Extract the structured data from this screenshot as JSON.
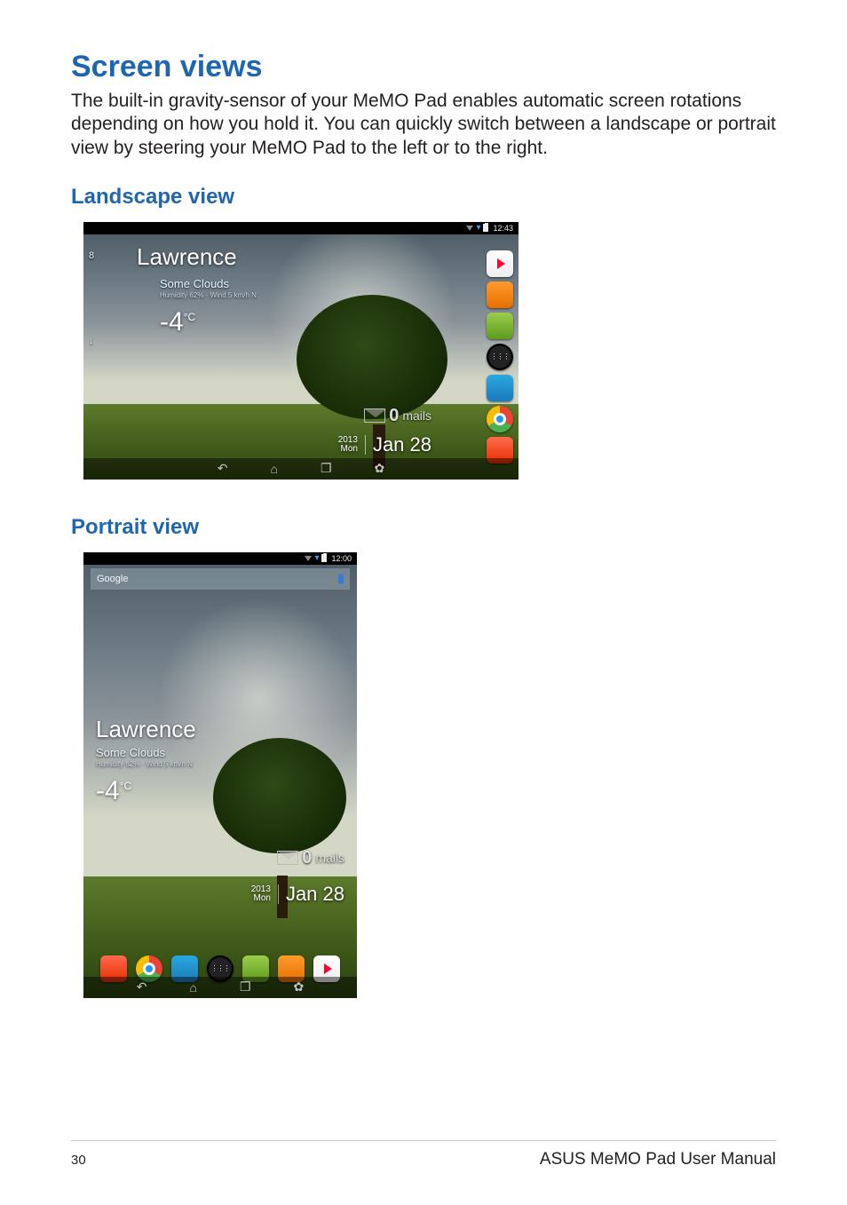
{
  "section": {
    "title": "Screen views",
    "body": "The built-in gravity-sensor of your MeMO Pad enables automatic screen rotations depending on how you hold it. You can quickly switch between a landscape or portrait view by steering your MeMO Pad to the left or to the right."
  },
  "landscape": {
    "heading": "Landscape view",
    "status_time": "12:43",
    "page_indicator_top": "8",
    "page_indicator_bottom": "↓",
    "weather": {
      "location": "Lawrence",
      "condition": "Some Clouds",
      "subline": "Humidity 62% · Wind 5 km/h N",
      "temperature": "-4",
      "temp_unit": "°C"
    },
    "mail": {
      "count": "0",
      "label": "mails"
    },
    "date": {
      "year": "2013",
      "dow": "Mon",
      "md": "Jan 28"
    },
    "quicklaunch": [
      "play-store",
      "audio-wizard",
      "supernote",
      "all-apps",
      "gallery",
      "chrome",
      "asus-studio"
    ],
    "navbar": [
      "back",
      "home",
      "recent",
      "screenshot"
    ]
  },
  "portrait": {
    "heading": "Portrait view",
    "status_time": "12:00",
    "search_placeholder": "Google",
    "weather": {
      "location": "Lawrence",
      "condition": "Some Clouds",
      "subline": "Humidity 62% · Wind 5 km/h N",
      "temperature": "-4",
      "temp_unit": "°C"
    },
    "mail": {
      "count": "0",
      "label": "mails"
    },
    "date": {
      "year": "2013",
      "dow": "Mon",
      "md": "Jan 28"
    },
    "quicklaunch": [
      "asus-studio",
      "chrome",
      "gallery",
      "all-apps",
      "supernote",
      "audio-wizard",
      "play-store"
    ],
    "navbar": [
      "back",
      "home",
      "recent",
      "screenshot"
    ]
  },
  "footer": {
    "page_number": "30",
    "title": "ASUS MeMO Pad User Manual"
  }
}
